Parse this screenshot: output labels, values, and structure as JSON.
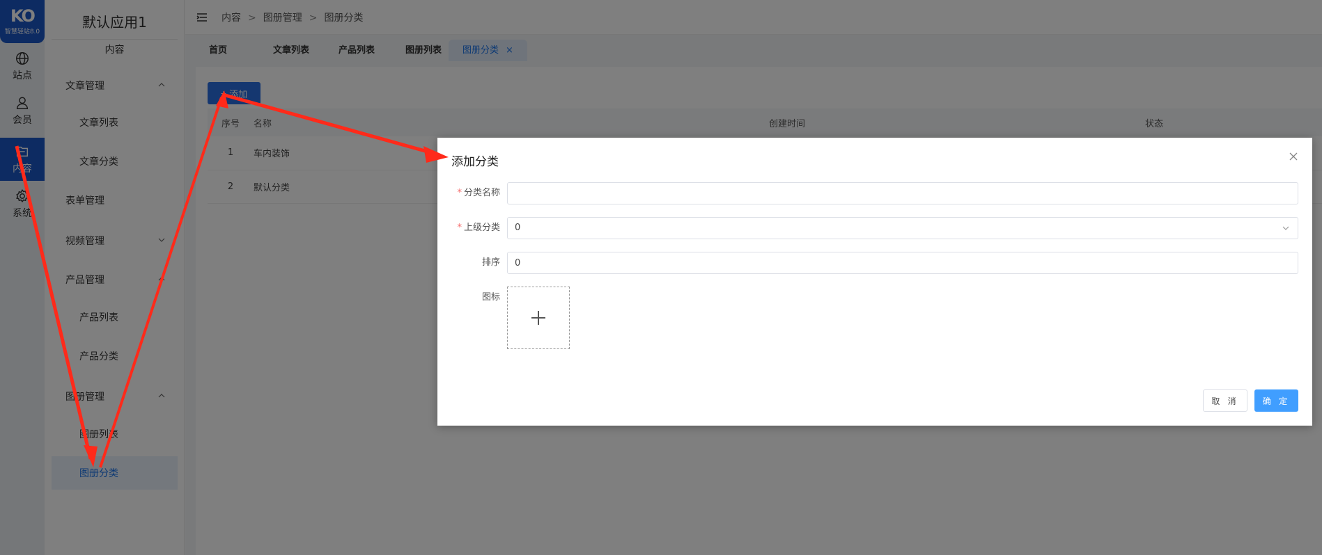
{
  "logo": {
    "mark": "KO",
    "sub": "智慧轻站8.0"
  },
  "rail": [
    {
      "label": "站点",
      "icon": "globe-icon"
    },
    {
      "label": "会员",
      "icon": "user-icon"
    },
    {
      "label": "内容",
      "icon": "folder-icon"
    },
    {
      "label": "系统",
      "icon": "gear-icon"
    }
  ],
  "submenu": {
    "app_title": "默认应用1",
    "section": "内容",
    "items": [
      {
        "label": "文章管理"
      },
      {
        "label": "文章列表"
      },
      {
        "label": "文章分类"
      },
      {
        "label": "表单管理"
      },
      {
        "label": "视频管理"
      },
      {
        "label": "产品管理"
      },
      {
        "label": "产品列表"
      },
      {
        "label": "产品分类"
      },
      {
        "label": "图册管理"
      },
      {
        "label": "图册列表"
      },
      {
        "label": "图册分类"
      }
    ]
  },
  "breadcrumb": {
    "items": [
      "内容",
      "图册管理",
      "图册分类"
    ],
    "sep": ">"
  },
  "tabs": [
    {
      "label": "首页"
    },
    {
      "label": "文章列表"
    },
    {
      "label": "产品列表"
    },
    {
      "label": "图册列表"
    },
    {
      "label": "图册分类",
      "close": "×"
    }
  ],
  "toolbar": {
    "add_label": "添加",
    "add_plus": "+"
  },
  "table": {
    "headers": [
      "序号",
      "名称",
      "创建时间",
      "状态"
    ],
    "rows": [
      {
        "index": "1",
        "name": "车内装饰"
      },
      {
        "index": "2",
        "name": "默认分类"
      }
    ]
  },
  "dialog": {
    "title": "添加分类",
    "required_mark": "*",
    "fields": {
      "name_label": "分类名称",
      "name_value": "",
      "parent_label": "上级分类",
      "parent_value": "0",
      "sort_label": "排序",
      "sort_value": "0",
      "icon_label": "图标"
    },
    "cancel_label": "取 消",
    "ok_label": "确 定"
  },
  "colors": {
    "accent": "#1a56c4",
    "annotation": "#ff2a1a",
    "primary_button": "#409eff"
  }
}
